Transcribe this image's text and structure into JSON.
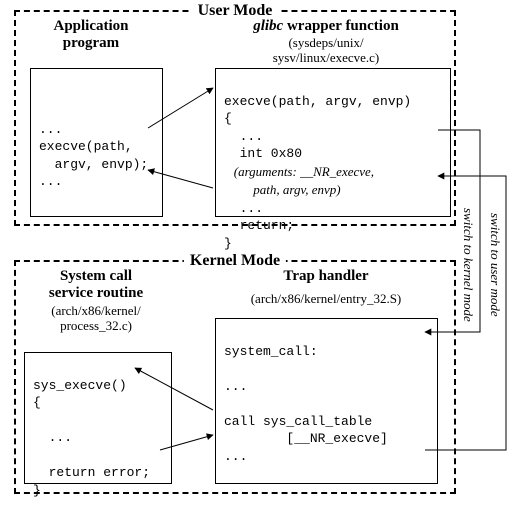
{
  "user_mode": {
    "title": "User Mode",
    "app": {
      "title": "Application\nprogram",
      "code": "...\nexecve(path,\n  argv, envp);\n..."
    },
    "glibc": {
      "title_html": "glibc wrapper function",
      "title_prefix_italic": "glibc",
      "title_rest": " wrapper function",
      "subtitle": "(sysdeps/unix/\nsysv/linux/execve.c)",
      "code_top": "execve(path, argv, envp)\n{\n  ...\n  int 0x80",
      "code_args_italic": "   (arguments: __NR_execve,\n         path, argv, envp)",
      "code_bottom": "  ...\n  return;\n}"
    }
  },
  "kernel_mode": {
    "title": "Kernel Mode",
    "service": {
      "title": "System call\nservice routine",
      "subtitle": "(arch/x86/kernel/\nprocess_32.c)",
      "code": "sys_execve()\n{\n\n  ...\n\n  return error;\n}"
    },
    "trap": {
      "title": "Trap handler",
      "subtitle": "(arch/x86/kernel/entry_32.S)",
      "code": "system_call:\n\n...\n\ncall sys_call_table\n        [__NR_execve]\n...\n"
    }
  },
  "side": {
    "to_kernel": "switch to kernel mode",
    "to_user": "switch to user mode"
  }
}
